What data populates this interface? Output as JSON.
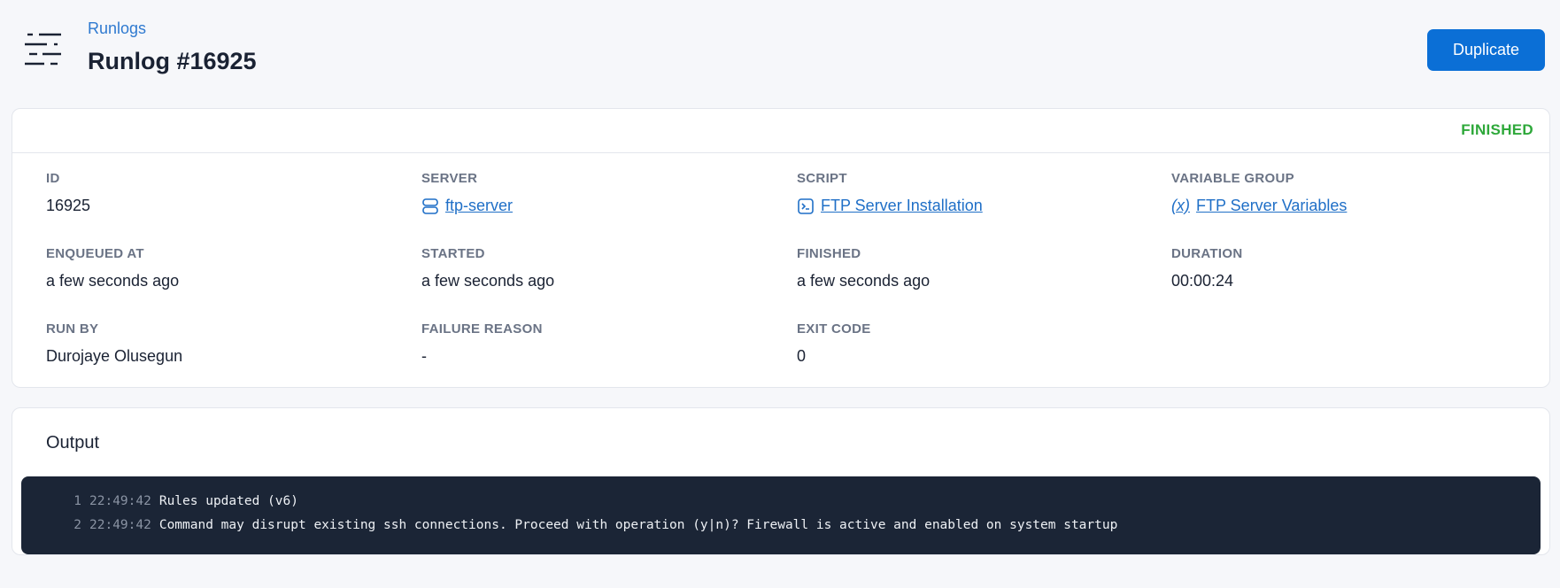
{
  "header": {
    "breadcrumb": "Runlogs",
    "title": "Runlog #16925",
    "duplicate_label": "Duplicate"
  },
  "details": {
    "status": "FINISHED",
    "status_color": "#2ea83a",
    "fields": [
      {
        "label": "ID",
        "value": "16925"
      },
      {
        "label": "SERVER",
        "value": "ftp-server",
        "icon": "server-icon"
      },
      {
        "label": "SCRIPT",
        "value": "FTP Server Installation",
        "icon": "terminal-icon"
      },
      {
        "label": "VARIABLE GROUP",
        "value": "FTP Server Variables",
        "icon": "variable-icon"
      },
      {
        "label": "ENQUEUED AT",
        "value": "a few seconds ago"
      },
      {
        "label": "STARTED",
        "value": "a few seconds ago"
      },
      {
        "label": "FINISHED",
        "value": "a few seconds ago"
      },
      {
        "label": "DURATION",
        "value": "00:00:24"
      },
      {
        "label": "RUN BY",
        "value": "Durojaye Olusegun"
      },
      {
        "label": "FAILURE REASON",
        "value": "-"
      },
      {
        "label": "EXIT CODE",
        "value": "0"
      }
    ]
  },
  "output": {
    "title": "Output",
    "lines": [
      {
        "n": "1",
        "time": "22:49:42",
        "text": "Rules updated (v6)"
      },
      {
        "n": "2",
        "time": "22:49:42",
        "text": "Command may disrupt existing ssh connections. Proceed with operation (y|n)? Firewall is active and enabled on system startup"
      }
    ]
  }
}
